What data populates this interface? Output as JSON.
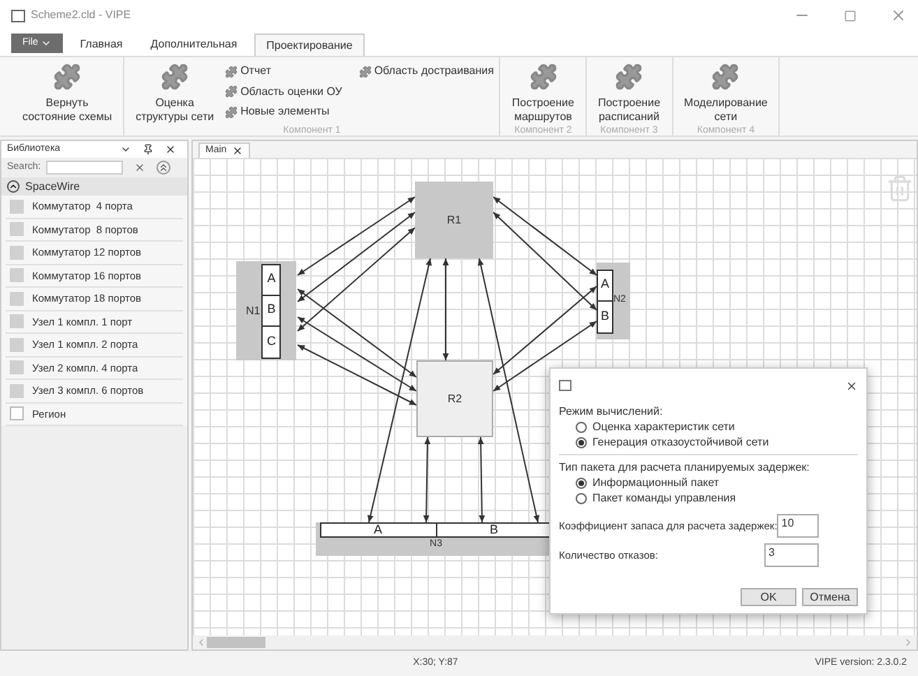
{
  "window": {
    "title": "Scheme2.cld - VIPE"
  },
  "file_button": "File",
  "tabs": [
    {
      "label": "Главная",
      "selected": false
    },
    {
      "label": "Дополнительная",
      "selected": false
    },
    {
      "label": "Проектирование",
      "selected": true
    }
  ],
  "ribbon": {
    "groups": [
      {
        "large_buttons": [
          "Вернуть\nсостояние схемы"
        ]
      },
      {
        "label": "Компонент 1",
        "large_buttons": [
          "Оценка\nструктуры сети"
        ],
        "small_buttons": [
          "Отчет",
          "Область оценки ОУ",
          "Новые элементы",
          "Область достраивания"
        ]
      },
      {
        "label": "Компонент 2",
        "large_buttons": [
          "Построение\nмаршрутов"
        ]
      },
      {
        "label": "Компонент 3",
        "large_buttons": [
          "Построение\nрасписаний"
        ]
      },
      {
        "label": "Компонент 4",
        "large_buttons": [
          "Моделирование\nсети"
        ]
      }
    ]
  },
  "library": {
    "title": "Библиотека",
    "search_label": "Search:",
    "group": {
      "label": "SpaceWire",
      "expanded": true,
      "items": [
        {
          "label": "Коммутатор  4 порта",
          "kind": "component"
        },
        {
          "label": "Коммутатор  8 портов",
          "kind": "component"
        },
        {
          "label": "Коммутатор 12 портов",
          "kind": "component"
        },
        {
          "label": "Коммутатор 16 портов",
          "kind": "component"
        },
        {
          "label": "Коммутатор 18 портов",
          "kind": "component"
        },
        {
          "label": "Узел 1 компл. 1 порт",
          "kind": "component"
        },
        {
          "label": "Узел 1 компл. 2 порта",
          "kind": "component"
        },
        {
          "label": "Узел 2 компл. 4 порта",
          "kind": "component"
        },
        {
          "label": "Узел 3 компл. 6 портов",
          "kind": "component"
        },
        {
          "label": "Регион",
          "kind": "region"
        }
      ]
    }
  },
  "document_tab": {
    "label": "Main"
  },
  "diagram": {
    "routers": [
      {
        "label": "R1",
        "selected": false
      },
      {
        "label": "R2",
        "selected": true
      }
    ],
    "nodes": [
      {
        "label": "N1",
        "ports": [
          "A",
          "B",
          "C"
        ]
      },
      {
        "label": "N2",
        "ports": [
          "A",
          "B"
        ]
      },
      {
        "label": "N3",
        "ports": [
          "A",
          "B"
        ]
      }
    ]
  },
  "dialog": {
    "mode_label": "Режим вычислений:",
    "mode_options": [
      {
        "label": "Оценка характеристик сети",
        "selected": false
      },
      {
        "label": "Генерация отказоустойчивой сети",
        "selected": true
      }
    ],
    "packet_label": "Тип пакета для расчета планируемых задержек:",
    "packet_options": [
      {
        "label": "Информационный пакет",
        "selected": true
      },
      {
        "label": "Пакет команды управления",
        "selected": false
      }
    ],
    "fields": [
      {
        "label": "Коэффициент запаса для расчета задержек:",
        "value": "10"
      },
      {
        "label": "Количество отказов:",
        "value": "3"
      }
    ],
    "buttons": [
      "OK",
      "Отмена"
    ]
  },
  "status_bar": {
    "coordinates": "X:30; Y:87",
    "version": "VIPE version: 2.3.0.2"
  }
}
